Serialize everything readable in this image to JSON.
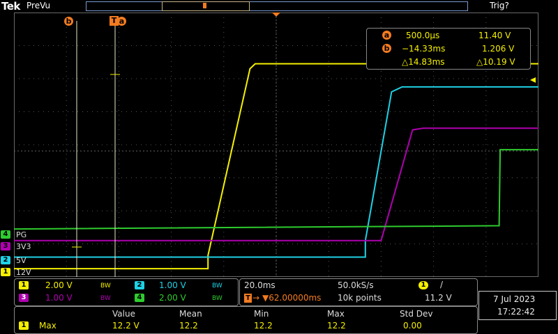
{
  "header": {
    "logo": "Tek",
    "status": "PreVu",
    "trigger_state": "Trig?"
  },
  "cursors": {
    "a_label": "a",
    "b_label": "b",
    "trigger_marker": "T",
    "a_time": "500.0µs",
    "a_value": "11.40 V",
    "b_time": "−14.33ms",
    "b_value": "1.206 V",
    "delta_time": "△14.83ms",
    "delta_value": "△10.19 V"
  },
  "channels": [
    {
      "num": "1",
      "name": "12V",
      "color": "#f5f000",
      "scale": "2.00 V",
      "bw": "BW"
    },
    {
      "num": "2",
      "name": "5V",
      "color": "#1ed2e6",
      "scale": "1.00 V",
      "bw": "BW"
    },
    {
      "num": "3",
      "name": "3V3",
      "color": "#b000b0",
      "scale": "1.00 V",
      "bw": "BW"
    },
    {
      "num": "4",
      "name": "PG",
      "color": "#2ecc2e",
      "scale": "2.00 V",
      "bw": "BW"
    }
  ],
  "timebase": {
    "time_div": "20.0ms",
    "sample_rate": "50.0kS/s",
    "trigger_pos": "▼62.00000ms",
    "record_length": "10k points",
    "trigger_source": "1",
    "trigger_slope": "/",
    "trigger_level": "11.2 V"
  },
  "datetime": {
    "date": "7 Jul  2023",
    "time": "17:22:42"
  },
  "measurements": {
    "headers": [
      "Value",
      "Mean",
      "Min",
      "Max",
      "Std Dev"
    ],
    "row": {
      "source": "1",
      "type": "Max",
      "values": [
        "12.2 V",
        "12.2",
        "12.2",
        "12.2",
        "0.00"
      ]
    }
  },
  "chart_data": {
    "type": "line",
    "x_divisions": 10,
    "y_divisions": 8,
    "series": [
      {
        "name": "12V",
        "points": [
          [
            0,
            7.75
          ],
          [
            3.7,
            7.75
          ],
          [
            3.7,
            7.35
          ],
          [
            4.5,
            1.7
          ],
          [
            4.6,
            1.55
          ],
          [
            10,
            1.55
          ]
        ]
      },
      {
        "name": "5V",
        "points": [
          [
            0,
            7.4
          ],
          [
            6.7,
            7.4
          ],
          [
            6.7,
            6.9
          ],
          [
            7.2,
            2.4
          ],
          [
            7.4,
            2.25
          ],
          [
            10,
            2.25
          ]
        ]
      },
      {
        "name": "3V3",
        "points": [
          [
            0,
            6.9
          ],
          [
            7.0,
            6.9
          ],
          [
            7.0,
            6.9
          ],
          [
            7.6,
            3.55
          ],
          [
            7.8,
            3.5
          ],
          [
            10,
            3.5
          ]
        ]
      },
      {
        "name": "PG",
        "points": [
          [
            0,
            6.55
          ],
          [
            9.25,
            6.45
          ],
          [
            9.27,
            4.15
          ],
          [
            10,
            4.15
          ]
        ]
      }
    ]
  }
}
